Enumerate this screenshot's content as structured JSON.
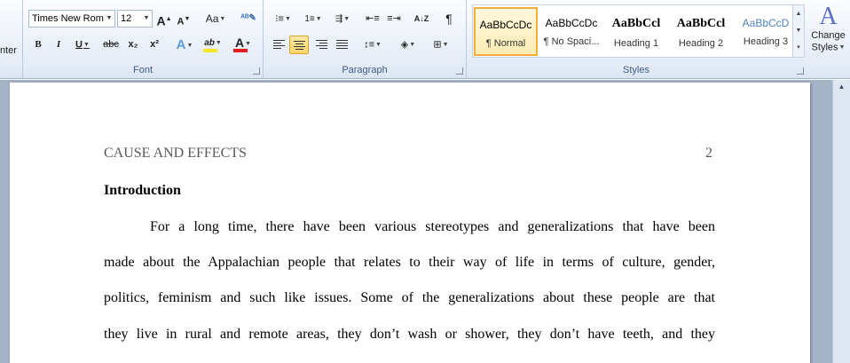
{
  "clipboard": {
    "center_label": "nter"
  },
  "font": {
    "group_label": "Font",
    "name": "Times New Rom",
    "size": "12",
    "grow_label": "A",
    "shrink_label": "A",
    "case_label": "Aa",
    "bold": "B",
    "italic": "I",
    "underline": "U",
    "strike": "abc",
    "subscript": "x₂",
    "superscript": "x²",
    "text_effects": "A",
    "highlight": "ab",
    "font_color": "A",
    "highlight_color": "#f5e727",
    "font_color_value": "#e31b1b"
  },
  "paragraph": {
    "group_label": "Paragraph",
    "pilcrow": "¶",
    "sort": "A↓Z"
  },
  "styles": {
    "group_label": "Styles",
    "items": [
      {
        "sample": "AaBbCcDc",
        "name": "¶ Normal"
      },
      {
        "sample": "AaBbCcDc",
        "name": "¶ No Spaci..."
      },
      {
        "sample": "AaBbCcl",
        "name": "Heading 1"
      },
      {
        "sample": "AaBbCcl",
        "name": "Heading 2"
      },
      {
        "sample": "AaBbCcD",
        "name": "Heading 3"
      }
    ],
    "change_styles_line1": "Change",
    "change_styles_line2": "Styles"
  },
  "document": {
    "header_text": "CAUSE AND EFFECTS",
    "page_number": "2",
    "heading": "Introduction",
    "lines": [
      "For a long time, there have been various stereotypes and generalizations that have been",
      "made about the Appalachian people that relates to their way of life in terms of culture, gender,",
      "politics, feminism and such like issues. Some of the generalizations about these people are that",
      "they live in rural and remote areas, they don’t wash or shower, they don’t have teeth, and they"
    ]
  }
}
